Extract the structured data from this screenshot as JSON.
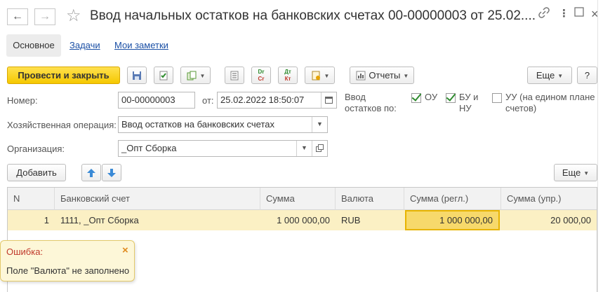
{
  "window": {
    "title": "Ввод начальных остатков на банковских счетах 00-00000003 от 25.02....",
    "back_icon": "arrow-left-icon",
    "forward_icon": "arrow-right-icon",
    "favorite_icon": "star-icon",
    "link_icon": "link-icon",
    "menu_icon": "more-vertical-icon",
    "maximize_icon": "maximize-icon",
    "close_icon": "close-icon"
  },
  "tabs": [
    {
      "label": "Основное",
      "active": true
    },
    {
      "label": "Задачи",
      "active": false
    },
    {
      "label": "Мои заметки",
      "active": false
    }
  ],
  "toolbar": {
    "post_close_label": "Провести и закрыть",
    "reports_label": "Отчеты",
    "more_label": "Еще",
    "help_label": "?",
    "icons": [
      "save-icon",
      "post-icon",
      "create-based-on-icon",
      "list-icon",
      "dt-kt-icon",
      "dt-kt-movements-icon",
      "attach-file-icon",
      "reports-icon"
    ],
    "dr_text": "Dr",
    "cr_text": "Cr",
    "dt_text": "Дт",
    "kt_text": "Кт"
  },
  "form": {
    "number_label": "Номер:",
    "number_value": "00-00000003",
    "date_label": "от:",
    "date_value": "25.02.2022 18:50:07",
    "balances_label": "Ввод остатков по:",
    "checkboxes": [
      {
        "label": "ОУ",
        "checked": true
      },
      {
        "label": "БУ и НУ",
        "checked": true
      },
      {
        "label": "УУ (на едином плане счетов)",
        "checked": false
      }
    ],
    "operation_label": "Хозяйственная операция:",
    "operation_value": "Ввод остатков на банковских счетах",
    "organization_label": "Организация:",
    "organization_value": "_Опт Сборка"
  },
  "table_toolbar": {
    "add_label": "Добавить",
    "move_up_icon": "arrow-up-icon",
    "move_down_icon": "arrow-down-icon",
    "more_label": "Еще"
  },
  "table": {
    "columns": [
      "N",
      "Банковский счет",
      "Сумма",
      "Валюта",
      "Сумма (регл.)",
      "Сумма (упр.)"
    ],
    "rows": [
      [
        "1",
        "1111, _Опт Сборка",
        "1 000 000,00",
        "RUB",
        "1 000 000,00",
        "20 000,00"
      ]
    ]
  },
  "error": {
    "title": "Ошибка:",
    "message": "Поле \"Валюта\" не заполнено",
    "close_icon": "close-icon"
  },
  "colors": {
    "accent_yellow": "#f5c800",
    "row_highlight": "#fbf0c4",
    "selected_cell": "#f7d96b",
    "link_blue": "#1a4fa5",
    "error_title": "#c0392b"
  }
}
